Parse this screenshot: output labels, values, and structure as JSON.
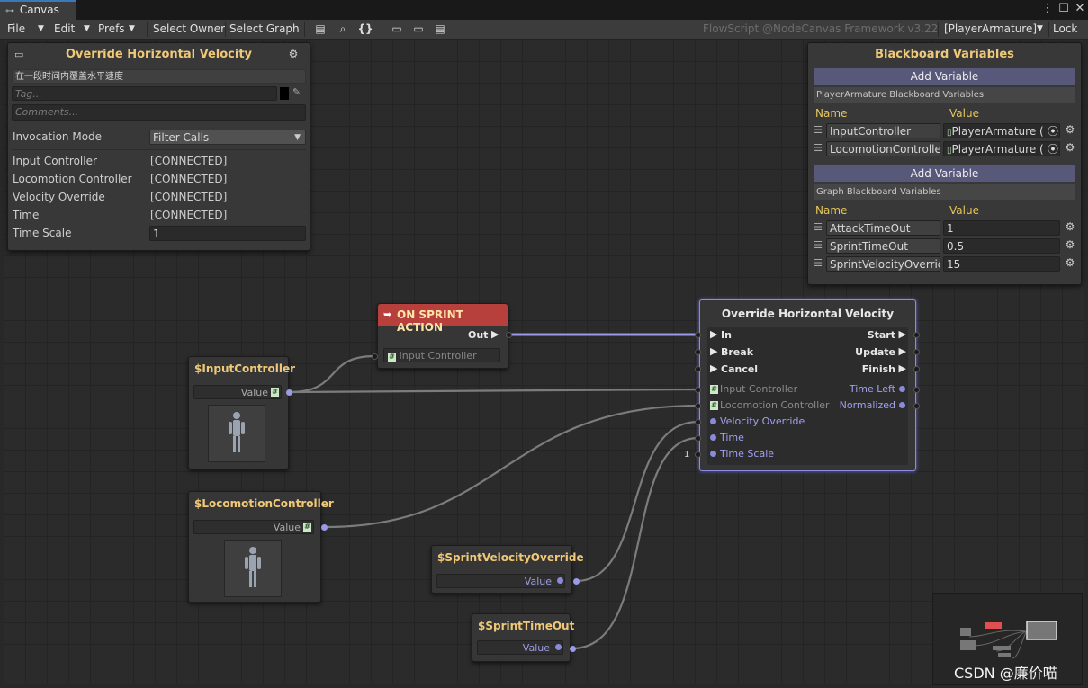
{
  "window": {
    "tab_title": "Canvas"
  },
  "toolbar": {
    "menus": [
      "File",
      "Edit",
      "Prefs"
    ],
    "select_owner": "Select Owner",
    "select_graph": "Select Graph",
    "watermark": "FlowScript @NodeCanvas Framework v3.22",
    "owner_dropdown": "[PlayerArmature]",
    "lock": "Lock"
  },
  "inspector": {
    "title": "Override Horizontal Velocity",
    "description": "在一段时间内覆盖水平速度",
    "tag_placeholder": "Tag...",
    "comments_placeholder": "Comments...",
    "invocation_mode_label": "Invocation Mode",
    "invocation_mode_value": "Filter Calls",
    "rows": [
      {
        "label": "Input Controller",
        "value": "[CONNECTED]"
      },
      {
        "label": "Locomotion Controller",
        "value": "[CONNECTED]"
      },
      {
        "label": "Velocity Override",
        "value": "[CONNECTED]"
      },
      {
        "label": "Time",
        "value": "[CONNECTED]"
      }
    ],
    "time_scale_label": "Time Scale",
    "time_scale_value": "1"
  },
  "blackboard": {
    "title": "Blackboard Variables",
    "add_variable": "Add Variable",
    "section1_header": "PlayerArmature Blackboard Variables",
    "section2_header": "Graph Blackboard Variables",
    "name_col": "Name",
    "value_col": "Value",
    "section1_vars": [
      {
        "name": "InputController",
        "value": "PlayerArmature ("
      },
      {
        "name": "LocomotionController",
        "value": "PlayerArmature ("
      }
    ],
    "section2_vars": [
      {
        "name": "AttackTimeOut",
        "value": "1"
      },
      {
        "name": "SprintTimeOut",
        "value": "0.5"
      },
      {
        "name": "SprintVelocityOverride",
        "value": "15"
      }
    ]
  },
  "nodes": {
    "sprint_action": {
      "title": "ON SPRINT ACTION",
      "out": "Out",
      "input": "Input Controller"
    },
    "input_controller": {
      "title": "$InputController",
      "value": "Value"
    },
    "locomotion_controller": {
      "title": "$LocomotionController",
      "value": "Value"
    },
    "sprint_velocity_override": {
      "title": "$SprintVelocityOverride",
      "value": "Value"
    },
    "sprint_timeout": {
      "title": "$SprintTimeOut",
      "value": "Value"
    },
    "override": {
      "title": "Override Horizontal Velocity",
      "flow_in": [
        "In",
        "Break",
        "Cancel"
      ],
      "flow_out": [
        "Start",
        "Update",
        "Finish"
      ],
      "inputs": [
        "Input Controller",
        "Locomotion Controller",
        "Velocity Override",
        "Time",
        "Time Scale"
      ],
      "outputs": [
        "Time Left",
        "Normalized"
      ],
      "time_scale_default": "1"
    }
  },
  "footer_watermark": "CSDN @廉价喵",
  "colors": {
    "accent_title": "#f0c978",
    "event_header": "#b8403c",
    "port": "#8a8ad8",
    "add_variable": "#58587a"
  }
}
